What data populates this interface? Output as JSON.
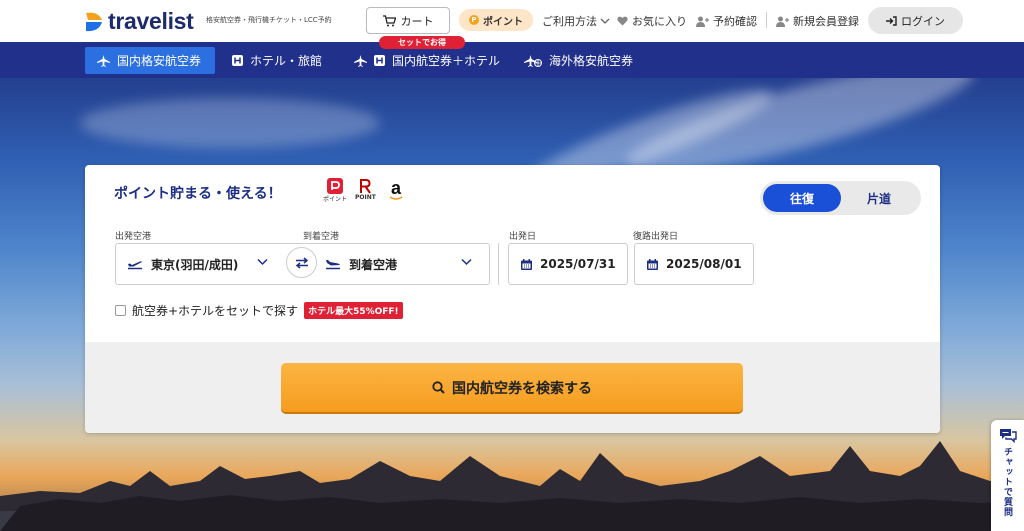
{
  "header": {
    "logo_text": "travelist",
    "tagline": "格安航空券・飛行機チケット・LCC予約",
    "cart_label": "カート",
    "point_label": "ポイント",
    "nav": [
      {
        "label": "ご利用方法"
      },
      {
        "label": "お気に入り"
      },
      {
        "label": "予約確認"
      },
      {
        "label": "新規会員登録"
      }
    ],
    "login_label": "ログイン"
  },
  "tabs": [
    {
      "label": "国内格安航空券",
      "active": true
    },
    {
      "label": "ホテル・旅館",
      "active": false
    },
    {
      "label": "国内航空券＋ホテル",
      "active": false
    },
    {
      "label": "海外格安航空券",
      "active": false
    }
  ],
  "set_badge": "セットでお得",
  "search": {
    "title": "ポイント貯まる・使える！",
    "point_logos": [
      {
        "label": "ポイント"
      },
      {
        "label": "POINT"
      },
      {
        "label": "a"
      }
    ],
    "trip_options": [
      {
        "label": "往復",
        "active": true
      },
      {
        "label": "片道",
        "active": false
      }
    ],
    "departure_label": "出発空港",
    "departure_value": "東京(羽田/成田)",
    "arrival_label": "到着空港",
    "arrival_value": "到着空港",
    "depart_date_label": "出発日",
    "depart_date_value": "2025/07/31",
    "return_date_label": "復路出発日",
    "return_date_value": "2025/08/01",
    "set_hotel_label": "航空券+ホテルをセットで探す",
    "hotel_badge": "ホテル最大55%OFF!",
    "search_button": "国内航空券を検索する"
  },
  "chat_label": "チャットで質問",
  "colors": {
    "navy": "#21308a",
    "active_tab": "#2b6fe0",
    "toggle_active": "#1a4fd8",
    "badge_red": "#e02035",
    "search_orange": "#f59c1e"
  }
}
